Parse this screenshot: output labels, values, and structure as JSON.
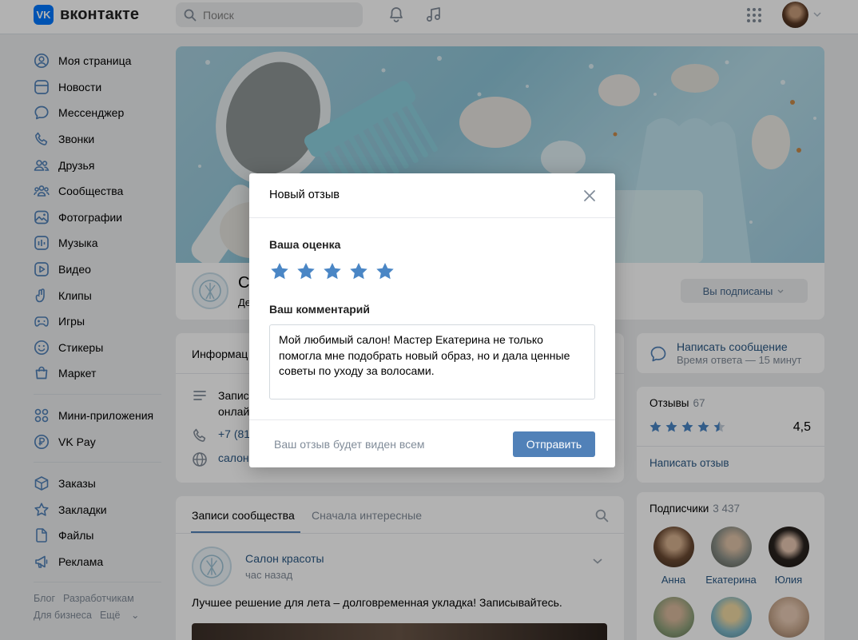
{
  "header": {
    "logo_mark": "VK",
    "logo_text": "вконтакте",
    "search_placeholder": "Поиск"
  },
  "sidebar": {
    "items": [
      {
        "label": "Моя страница",
        "icon": "user-circle-icon"
      },
      {
        "label": "Новости",
        "icon": "news-icon"
      },
      {
        "label": "Мессенджер",
        "icon": "message-icon"
      },
      {
        "label": "Звонки",
        "icon": "phone-icon"
      },
      {
        "label": "Друзья",
        "icon": "friends-icon"
      },
      {
        "label": "Сообщества",
        "icon": "communities-icon"
      },
      {
        "label": "Фотографии",
        "icon": "photo-icon"
      },
      {
        "label": "Музыка",
        "icon": "music-icon"
      },
      {
        "label": "Видео",
        "icon": "video-icon"
      },
      {
        "label": "Клипы",
        "icon": "clips-icon"
      },
      {
        "label": "Игры",
        "icon": "gamepad-icon"
      },
      {
        "label": "Стикеры",
        "icon": "smile-icon"
      },
      {
        "label": "Маркет",
        "icon": "market-bag-icon"
      }
    ],
    "items2": [
      {
        "label": "Мини-приложения",
        "icon": "apps-icon"
      },
      {
        "label": "VK Pay",
        "icon": "vkpay-icon"
      }
    ],
    "items3": [
      {
        "label": "Заказы",
        "icon": "box-icon"
      },
      {
        "label": "Закладки",
        "icon": "star-outline-icon"
      },
      {
        "label": "Файлы",
        "icon": "file-icon"
      },
      {
        "label": "Реклама",
        "icon": "megaphone-icon"
      }
    ],
    "footer": {
      "blog": "Блог",
      "developers": "Разработчикам",
      "business": "Для бизнеса",
      "more": "Ещё"
    }
  },
  "profile": {
    "name_partial": "С",
    "sub_partial": "Де",
    "subscribed_label": "Вы подписаны"
  },
  "info": {
    "title_partial": "Информац",
    "line1_partial": "Запис",
    "line2_partial": "онлай",
    "phone_partial": "+7 (81",
    "site_partial": "салон"
  },
  "message_card": {
    "title": "Написать сообщение",
    "subtitle": "Время ответа — 15 минут"
  },
  "reviews": {
    "title": "Отзывы",
    "count": "67",
    "rating_display": "4,5",
    "rating_value": 4.5,
    "write_label": "Написать отзыв"
  },
  "subscribers": {
    "title": "Подписчики",
    "count": "3 437",
    "people": [
      {
        "name": "Анна"
      },
      {
        "name": "Екатерина"
      },
      {
        "name": "Юлия"
      }
    ]
  },
  "posts": {
    "tab_active": "Записи сообщества",
    "tab_other": "Сначала интересные",
    "author": "Салон красоты",
    "time": "час назад",
    "text": "Лучшее решение для лета – долговременная укладка! Записывайтесь."
  },
  "modal": {
    "title": "Новый отзыв",
    "rating_label": "Ваша оценка",
    "rating_value": 5,
    "comment_label": "Ваш комментарий",
    "comment_value": "Мой любимый салон! Мастер Екатерина не только помогла мне подобрать новый образ, но и дала ценные советы по уходу за волосами.",
    "footer_note": "Ваш отзыв будет виден всем",
    "submit_label": "Отправить"
  },
  "colors": {
    "accent": "#5181b8",
    "link": "#2a5885",
    "star": "#4a86c5",
    "logo": "#0077ff"
  }
}
